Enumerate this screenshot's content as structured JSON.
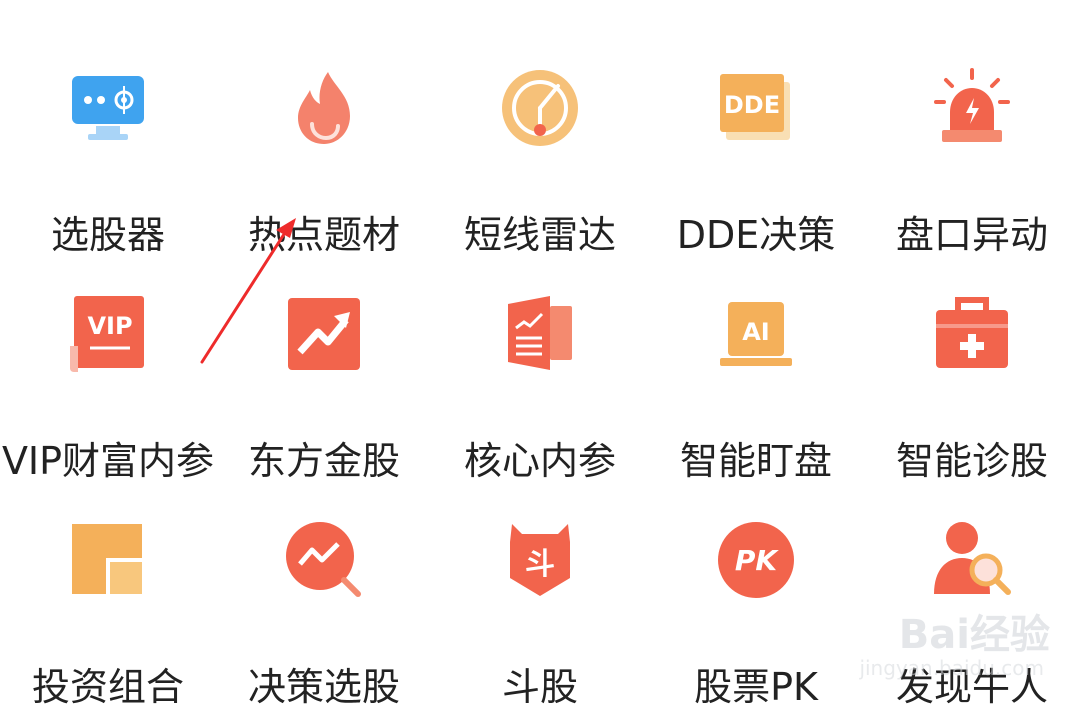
{
  "menu": {
    "rows": [
      [
        {
          "label": "选股器",
          "icon": "monitor-screener-icon"
        },
        {
          "label": "热点题材",
          "icon": "flame-icon"
        },
        {
          "label": "短线雷达",
          "icon": "radar-icon"
        },
        {
          "label": "DDE决策",
          "icon": "dde-document-icon",
          "icon_text": "DDE"
        },
        {
          "label": "盘口异动",
          "icon": "siren-alarm-icon"
        }
      ],
      [
        {
          "label": "VIP财富内参",
          "icon": "vip-document-icon",
          "icon_text": "VIP"
        },
        {
          "label": "东方金股",
          "icon": "trend-up-icon"
        },
        {
          "label": "核心内参",
          "icon": "book-chart-icon"
        },
        {
          "label": "智能盯盘",
          "icon": "ai-laptop-icon",
          "icon_text": "AI"
        },
        {
          "label": "智能诊股",
          "icon": "medical-kit-icon"
        }
      ],
      [
        {
          "label": "投资组合",
          "icon": "portfolio-blocks-icon"
        },
        {
          "label": "决策选股",
          "icon": "chart-magnifier-icon"
        },
        {
          "label": "斗股",
          "icon": "dou-badge-icon",
          "icon_text": "斗"
        },
        {
          "label": "股票PK",
          "icon": "pk-circle-icon",
          "icon_text": "PK"
        },
        {
          "label": "发现牛人",
          "icon": "person-search-icon"
        }
      ]
    ]
  },
  "watermark": {
    "main": "Bai经验",
    "sub": "jingyan.baidu.com"
  },
  "colors": {
    "coral": "#f2644c",
    "orange": "#f4b05a",
    "blue": "#3fa3ef",
    "label": "#222222"
  }
}
